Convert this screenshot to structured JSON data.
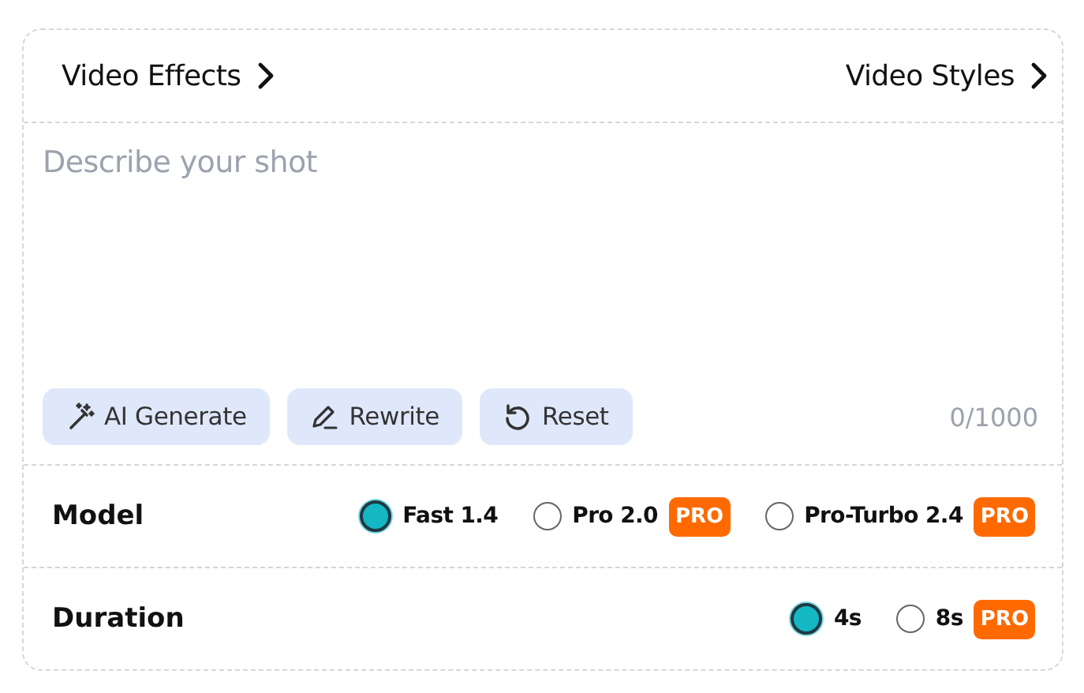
{
  "header": {
    "links": [
      {
        "label": "Video Effects"
      },
      {
        "label": "Video Styles"
      }
    ]
  },
  "prompt": {
    "placeholder": "Describe your shot",
    "counter": "0/1000"
  },
  "actions": [
    {
      "label": "AI Generate",
      "kind": "wand"
    },
    {
      "label": "Rewrite",
      "kind": "pen"
    },
    {
      "label": "Reset",
      "kind": "reset"
    }
  ],
  "settings": [
    {
      "label": "Model",
      "options": [
        {
          "label": "Fast 1.4",
          "selected": true
        },
        {
          "label": "Pro 2.0",
          "selected": false,
          "badge": "PRO"
        },
        {
          "label": "Pro-Turbo 2.4",
          "selected": false,
          "badge": "PRO"
        }
      ]
    },
    {
      "label": "Duration",
      "options": [
        {
          "label": "4s",
          "selected": true
        },
        {
          "label": "8s",
          "selected": false,
          "badge": "PRO"
        }
      ]
    }
  ]
}
